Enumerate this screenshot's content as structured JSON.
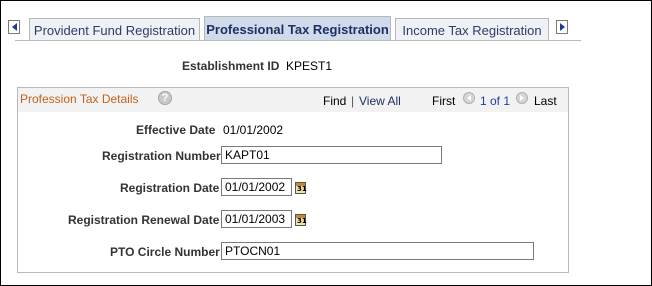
{
  "tabs": [
    {
      "label": "Provident Fund Registration",
      "active": false
    },
    {
      "label": "Professional Tax Registration",
      "active": true
    },
    {
      "label": "Income Tax Registration",
      "active": false
    }
  ],
  "header": {
    "establishment_label": "Establishment ID",
    "establishment_value": "KPEST1"
  },
  "group": {
    "title": "Profession Tax Details",
    "help_symbol": "?",
    "find_label": "Find",
    "separator": "|",
    "view_all_label": "View All",
    "first_label": "First",
    "page_text": "1 of 1",
    "last_label": "Last"
  },
  "fields": {
    "effective_date_label": "Effective Date",
    "effective_date_value": "01/01/2002",
    "registration_number_label": "Registration Number",
    "registration_number_value": "KAPT01",
    "registration_date_label": "Registration Date",
    "registration_date_value": "01/01/2002",
    "registration_renewal_date_label": "Registration Renewal Date",
    "registration_renewal_date_value": "01/01/2003",
    "pto_circle_number_label": "PTO Circle Number",
    "pto_circle_number_value": "PTOCN01"
  },
  "calendar_icon_text": "31"
}
